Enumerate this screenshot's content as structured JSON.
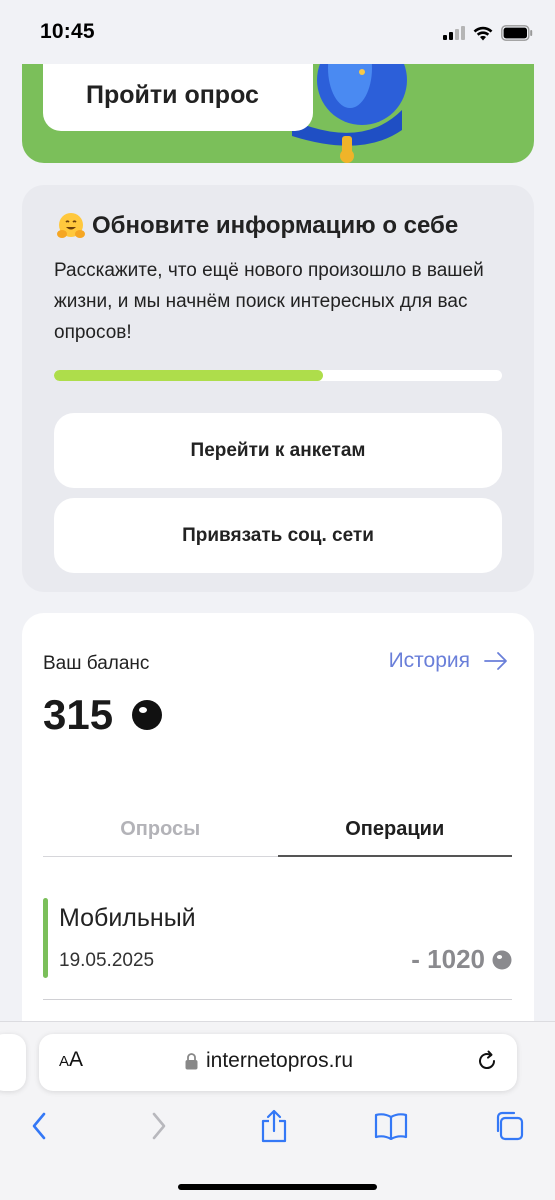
{
  "status_bar": {
    "time": "10:45"
  },
  "survey_banner": {
    "button_label": "Пройти опрос"
  },
  "info_card": {
    "title": "Обновите информацию о себе",
    "description": "Расскажите, что ещё нового произошло в вашей жизни, и мы начнём поиск интересных для вас опросов!",
    "progress": 0.6,
    "forms_button": "Перейти к анкетам",
    "social_button": "Привязать соц. сети"
  },
  "balance": {
    "label": "Ваш баланс",
    "history_link": "История",
    "amount": "315",
    "tabs": [
      {
        "label": "Опросы",
        "active": false
      },
      {
        "label": "Операции",
        "active": true
      }
    ],
    "operations": [
      {
        "title": "Мобильный",
        "date": "19.05.2025",
        "amount": "- 1020"
      }
    ]
  },
  "browser": {
    "text_size_label_small": "A",
    "text_size_label_big": "A",
    "url": "internetopros.ru"
  },
  "colors": {
    "accent_green": "#7bbf5a",
    "progress_green": "#aedd4b",
    "link_blue": "#6a7fd9",
    "safari_blue": "#3478f6"
  }
}
